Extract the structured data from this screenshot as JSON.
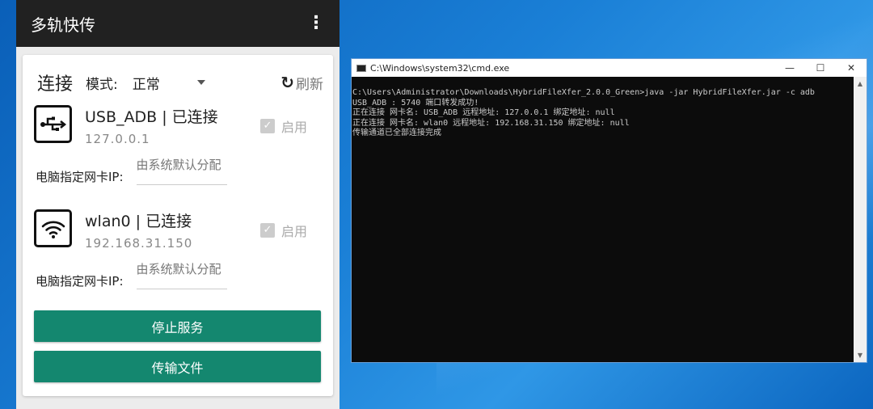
{
  "app": {
    "title": "多轨快传",
    "menu_icon": "more-vert-icon",
    "section": "连接",
    "mode_label": "模式:",
    "mode_value": "正常",
    "refresh_label": "刷新",
    "devices": [
      {
        "name": "USB_ADB | 已连接",
        "ip": "127.0.0.1",
        "enable_label": "启用",
        "enabled": true,
        "ip_label": "电脑指定网卡IP:",
        "ip_value": "由系统默认分配",
        "icon": "usb-icon"
      },
      {
        "name": "wlan0 | 已连接",
        "ip": "192.168.31.150",
        "enable_label": "启用",
        "enabled": true,
        "ip_label": "电脑指定网卡IP:",
        "ip_value": "由系统默认分配",
        "icon": "wifi-icon"
      }
    ],
    "stop_button": "停止服务",
    "transfer_button": "传输文件"
  },
  "cmd": {
    "title": "C:\\Windows\\system32\\cmd.exe",
    "lines": [
      "C:\\Users\\Administrator\\Downloads\\HybridFileXfer_2.0.0_Green>java -jar HybridFileXfer.jar -c adb",
      "USB_ADB : 5740 端口转发成功!",
      "正在连接 网卡名: USB_ADB 远程地址: 127.0.0.1 绑定地址: null",
      "正在连接 网卡名: wlan0 远程地址: 192.168.31.150 绑定地址: null",
      "传输通道已全部连接完成"
    ]
  },
  "colors": {
    "accent": "#14876f",
    "appbar": "#212121"
  }
}
